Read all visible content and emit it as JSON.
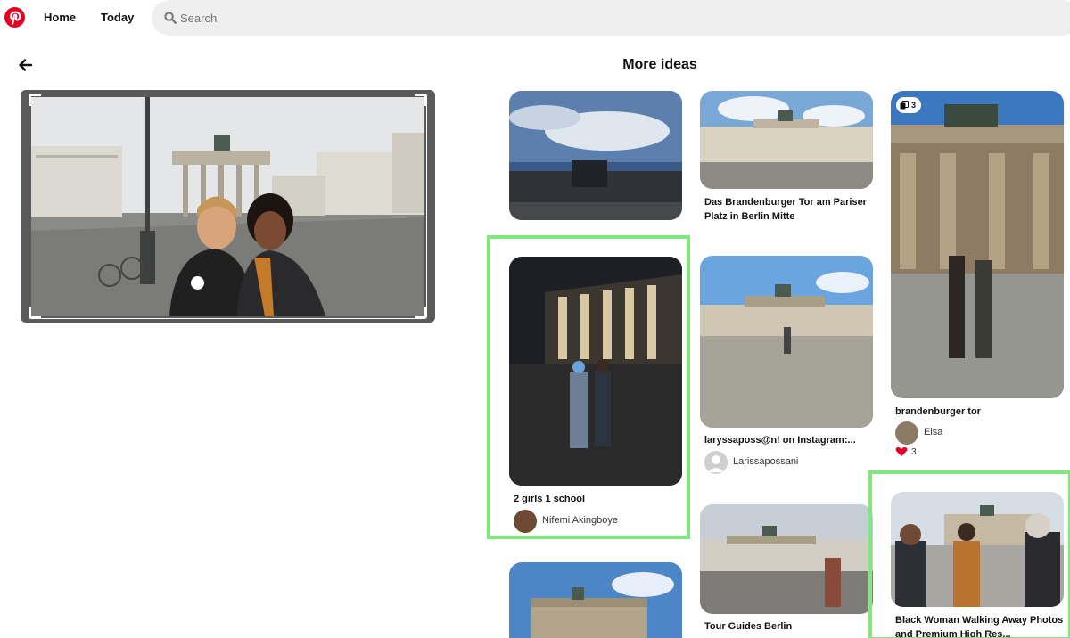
{
  "header": {
    "nav": {
      "home": "Home",
      "today": "Today"
    },
    "search": {
      "placeholder": "Search",
      "value": ""
    }
  },
  "main": {
    "title": "More ideas"
  },
  "pins": [
    {
      "title": "",
      "creator": ""
    },
    {
      "title": "Das Brandenburger Tor am Pariser Platz in Berlin Mitte",
      "creator": ""
    },
    {
      "title": "brandenburger tor",
      "creator": "Elsa",
      "board_count": "3",
      "reaction_count": "3"
    },
    {
      "title": "2 girls 1 school",
      "creator": "Nifemi Akingboye"
    },
    {
      "title": "laryssaposs@n! on Instagram:...",
      "creator": "Larissapossani"
    },
    {
      "title": "Black Woman Walking Away Photos and Premium High Res...",
      "creator": ""
    },
    {
      "title": "Tour Guides Berlin",
      "creator": ""
    },
    {
      "title": "",
      "creator": ""
    }
  ],
  "colors": {
    "brand": "#e60023",
    "highlight": "#7fe87c",
    "search_bg": "#efefef"
  }
}
